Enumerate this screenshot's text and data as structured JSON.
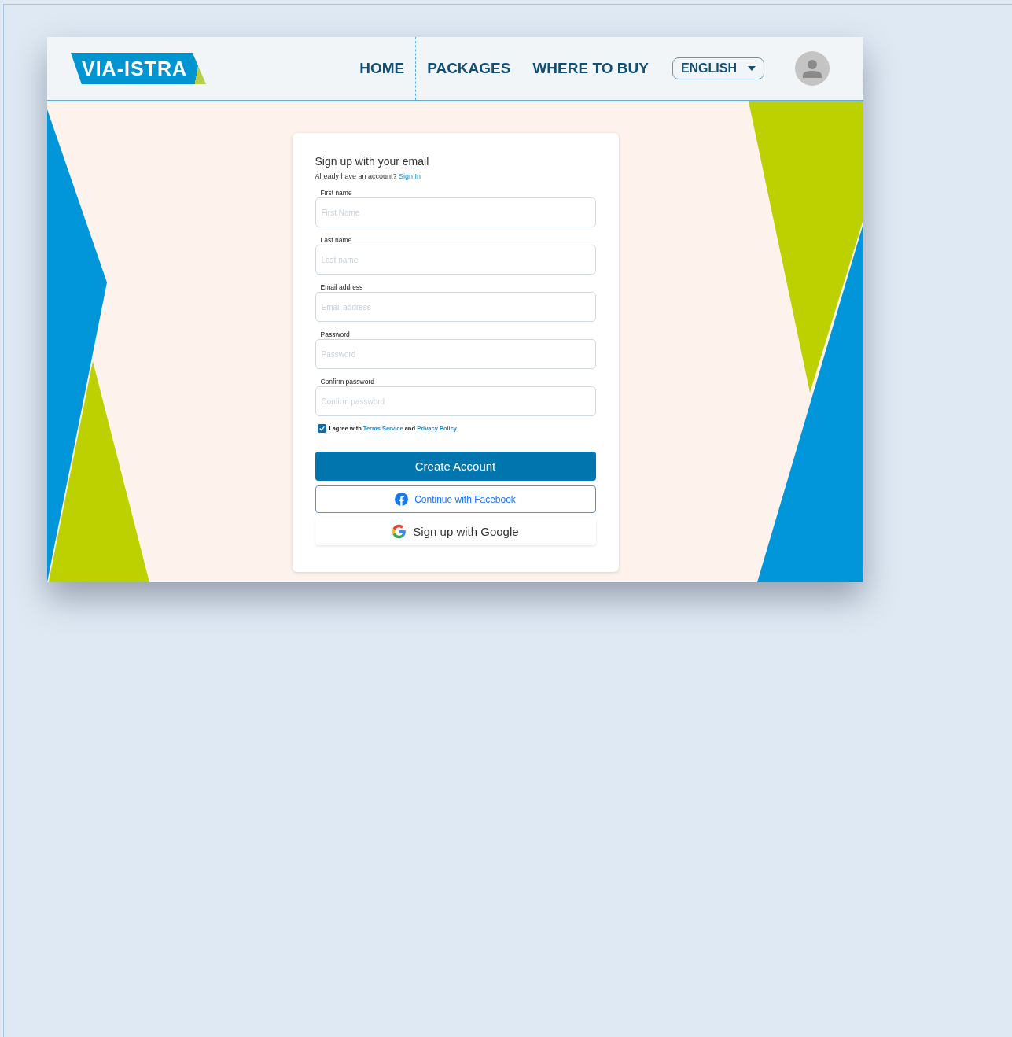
{
  "header": {
    "logo": "VIA-ISTRA",
    "nav": [
      {
        "label": "HOME",
        "selected": false
      },
      {
        "label": "PACKAGES",
        "selected": false
      },
      {
        "label": "WHERE TO BUY",
        "selected": false
      }
    ],
    "language": "ENGLISH"
  },
  "form": {
    "title": "Sign up with your email",
    "signin_prompt": "Already have an account?",
    "signin_link": "Sign In",
    "fields": [
      {
        "label": "First name",
        "placeholder": "First Name"
      },
      {
        "label": "Last name",
        "placeholder": "Last name"
      },
      {
        "label": "Email address",
        "placeholder": "Email address"
      },
      {
        "label": "Password",
        "placeholder": "Password"
      },
      {
        "label": "Confirm password",
        "placeholder": "Confirm password"
      }
    ],
    "agreement": {
      "checked": true,
      "text_before": "I agree with",
      "terms_link": "Terms Service",
      "conjunction": "and",
      "privacy_link": "Privacy Policy"
    },
    "buttons": [
      {
        "kind": "primary",
        "label": "Create Account"
      },
      {
        "kind": "facebook",
        "label": "Continue with Facebook"
      },
      {
        "kind": "google",
        "label": "Sign up with Google"
      }
    ]
  }
}
